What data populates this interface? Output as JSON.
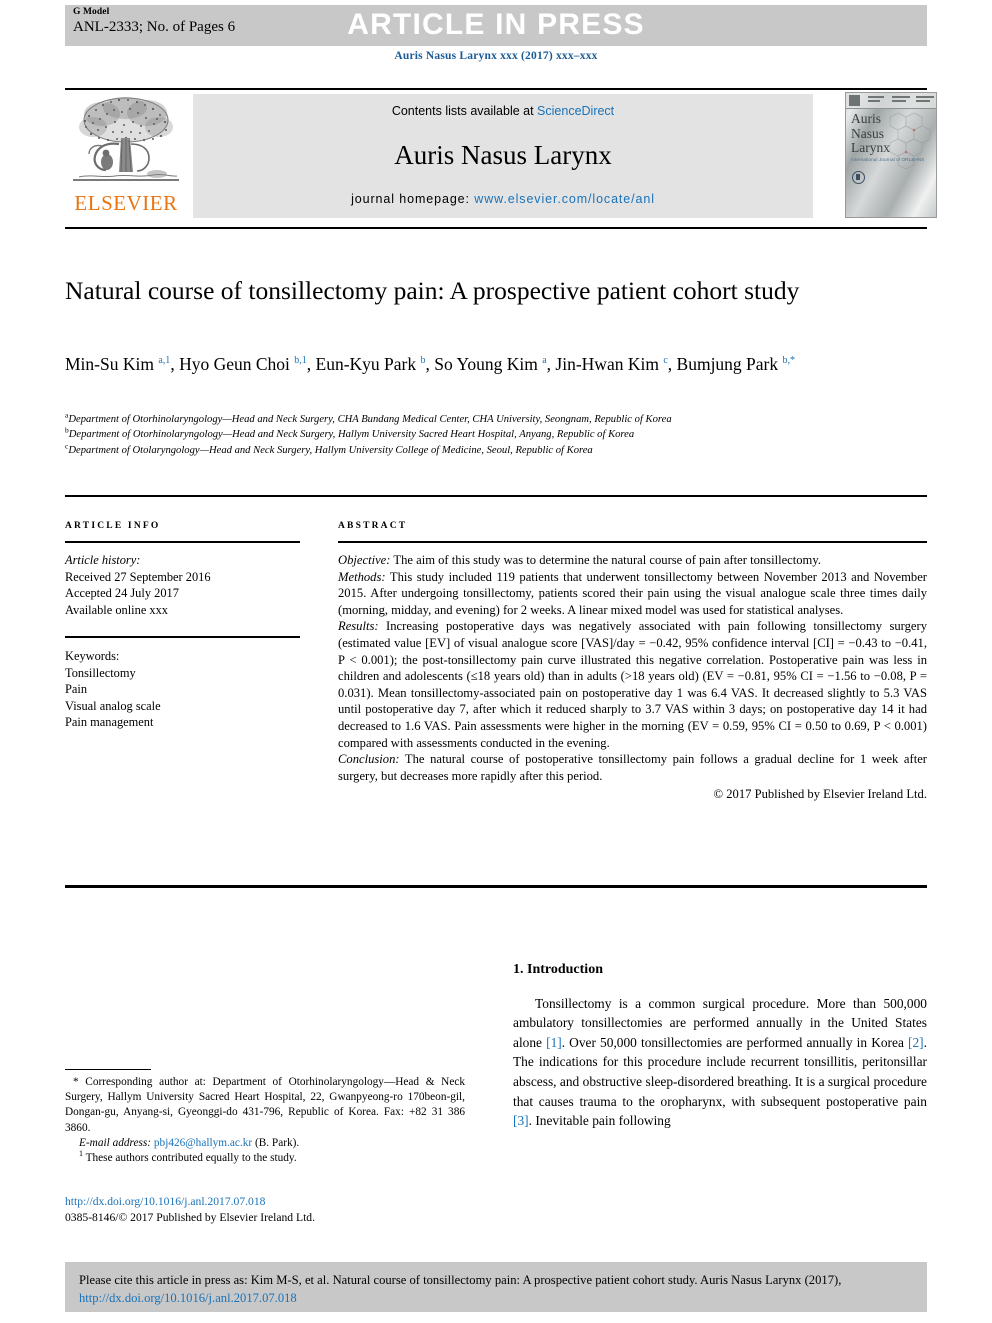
{
  "topbar": {
    "g_model": "G Model",
    "article_id": "ANL-2333; No. of Pages 6",
    "banner": "ARTICLE IN PRESS"
  },
  "journal_citation": "Auris Nasus Larynx xxx (2017) xxx–xxx",
  "masthead": {
    "publisher_wordmark": "ELSEVIER",
    "contents_prefix": "Contents lists available at ",
    "contents_link": "ScienceDirect",
    "journal_name": "Auris Nasus Larynx",
    "homepage_prefix": "journal homepage: ",
    "homepage_url": "www.elsevier.com/locate/anl",
    "cover_title": "Auris Nasus Larynx",
    "cover_subtitle": "International Journal of ORL&HNS"
  },
  "article": {
    "title": "Natural course of tonsillectomy pain: A prospective patient cohort study",
    "authors_html": "Min-Su Kim <sup>a,1</sup>, Hyo Geun Choi <sup>b,1</sup>, Eun-Kyu Park <sup>b</sup>, So Young Kim <sup>a</sup>, Jin-Hwan Kim <sup>c</sup>, Bumjung Park <sup>b,*</sup>",
    "affiliations": [
      {
        "marker": "a",
        "text": "Department of Otorhinolaryngology—Head and Neck Surgery, CHA Bundang Medical Center, CHA University, Seongnam, Republic of Korea"
      },
      {
        "marker": "b",
        "text": "Department of Otorhinolaryngology—Head and Neck Surgery, Hallym University Sacred Heart Hospital, Anyang, Republic of Korea"
      },
      {
        "marker": "c",
        "text": "Department of Otolaryngology—Head and Neck Surgery, Hallym University College of Medicine, Seoul, Republic of Korea"
      }
    ]
  },
  "article_info": {
    "heading": "ARTICLE INFO",
    "history_label": "Article history:",
    "history": [
      "Received 27 September 2016",
      "Accepted 24 July 2017",
      "Available online xxx"
    ],
    "keywords_label": "Keywords:",
    "keywords": [
      "Tonsillectomy",
      "Pain",
      "Visual analog scale",
      "Pain management"
    ]
  },
  "abstract": {
    "heading": "ABSTRACT",
    "objective_label": "Objective:",
    "objective_text": " The aim of this study was to determine the natural course of pain after tonsillectomy.",
    "methods_label": "Methods:",
    "methods_text": " This study included 119 patients that underwent tonsillectomy between November 2013 and November 2015. After undergoing tonsillectomy, patients scored their pain using the visual analogue scale three times daily (morning, midday, and evening) for 2 weeks. A linear mixed model was used for statistical analyses.",
    "results_label": "Results:",
    "results_text": " Increasing postoperative days was negatively associated with pain following tonsillectomy surgery (estimated value [EV] of visual analogue score [VAS]/day = −0.42, 95% confidence interval [CI] = −0.43 to −0.41, P < 0.001); the post-tonsillectomy pain curve illustrated this negative correlation. Postoperative pain was less in children and adolescents (≤18 years old) than in adults (>18 years old) (EV = −0.81, 95% CI = −1.56 to −0.08, P = 0.031). Mean tonsillectomy-associated pain on postoperative day 1 was 6.4 VAS. It decreased slightly to 5.3 VAS until postoperative day 7, after which it reduced sharply to 3.7 VAS within 3 days; on postoperative day 14 it had decreased to 1.6 VAS. Pain assessments were higher in the morning (EV = 0.59, 95% CI = 0.50 to 0.69, P < 0.001) compared with assessments conducted in the evening.",
    "conclusion_label": "Conclusion:",
    "conclusion_text": " The natural course of postoperative tonsillectomy pain follows a gradual decline for 1 week after surgery, but decreases more rapidly after this period.",
    "copyright": "© 2017 Published by Elsevier Ireland Ltd."
  },
  "introduction": {
    "heading": "1. Introduction",
    "paragraph_1a": "Tonsillectomy is a common surgical procedure. More than 500,000 ambulatory tonsillectomies are performed annually in the United States alone ",
    "ref1": "[1]",
    "paragraph_1b": ". Over 50,000 tonsillectomies are performed annually in Korea ",
    "ref2": "[2]",
    "paragraph_1c": ". The indications for this procedure include recurrent tonsillitis, peritonsillar abscess, and obstructive sleep-disordered breathing. It is a surgical procedure that causes trauma to the oropharynx, with subsequent postoperative pain ",
    "ref3": "[3]",
    "paragraph_1d": ". Inevitable pain following"
  },
  "footnotes": {
    "corresponding_marker": "*",
    "corresponding": " Corresponding author at: Department of Otorhinolaryngology—Head & Neck Surgery, Hallym University Sacred Heart Hospital, 22, Gwanpyeong-ro 170beon-gil, Dongan-gu, Anyang-si, Gyeonggi-do 431-796, Republic of Korea. Fax: +82 31 386 3860.",
    "email_label": "E-mail address:",
    "email": "pbj426@hallym.ac.kr",
    "email_owner": " (B. Park).",
    "equal_marker": "1",
    "equal_contribution": " These authors contributed equally to the study."
  },
  "doi_block": {
    "doi_url": "http://dx.doi.org/10.1016/j.anl.2017.07.018",
    "issn_line": "0385-8146/© 2017 Published by Elsevier Ireland Ltd."
  },
  "cite_box": {
    "text_before": "Please cite this article in press as: Kim M-S, et al. Natural course of tonsillectomy pain: A prospective patient cohort study. Auris Nasus Larynx (2017), ",
    "link": "http://dx.doi.org/10.1016/j.anl.2017.07.018"
  },
  "colors": {
    "link_blue": "#1a72b8",
    "citation_blue": "#1a5b96",
    "elsevier_orange": "#e87511",
    "bar_grey": "#c8c8c8",
    "masthead_grey": "#e3e3e3"
  }
}
